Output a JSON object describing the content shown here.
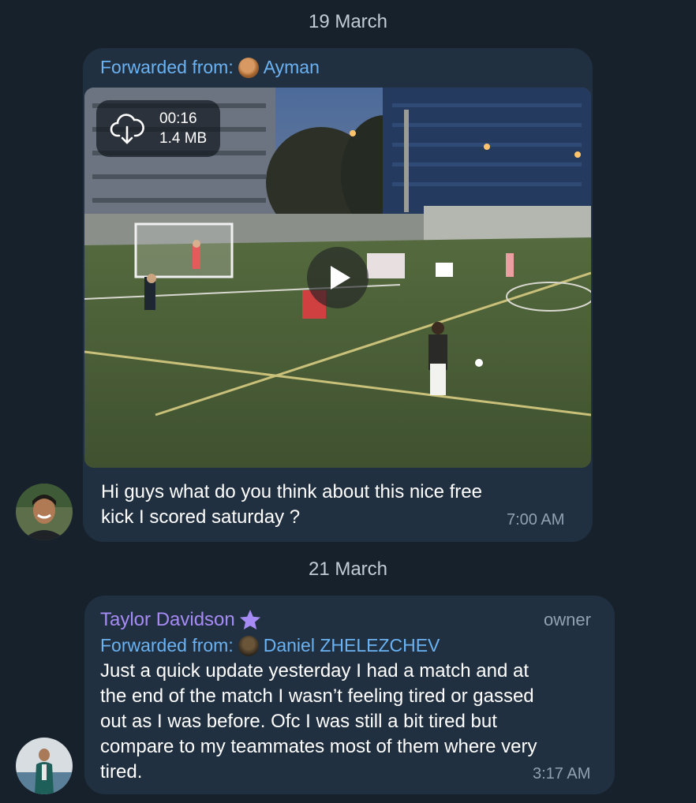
{
  "messages": [
    {
      "date": "19 March",
      "forwarded_label": "Forwarded from:",
      "forwarded_name": "Ayman",
      "video": {
        "duration": "00:16",
        "size": "1.4 MB"
      },
      "text_lines": [
        "Hi guys what do you think about this nice free",
        "kick I scored saturday ?"
      ],
      "time": "7:00 AM"
    },
    {
      "date": "21 March",
      "sender": "Taylor Davidson",
      "role": "owner",
      "forwarded_label": "Forwarded from:",
      "forwarded_name": "Daniel ZHELEZCHEV",
      "text_lines": [
        "Just a quick update yesterday I had a match and at",
        "the end of the match I wasn’t feeling tired or gassed",
        "out as I was before. Ofc I was still a bit tired but",
        "compare to my teammates most of them where very",
        "tired."
      ],
      "time": "3:17 AM"
    }
  ],
  "icons": {
    "download": "cloud-download-icon",
    "play": "play-icon",
    "badge": "star-icon"
  },
  "colors": {
    "background": "#17212b",
    "bubble": "#213040",
    "link": "#6ab2f2",
    "sender": "#a78bf5",
    "meta": "#8fa1b3"
  }
}
